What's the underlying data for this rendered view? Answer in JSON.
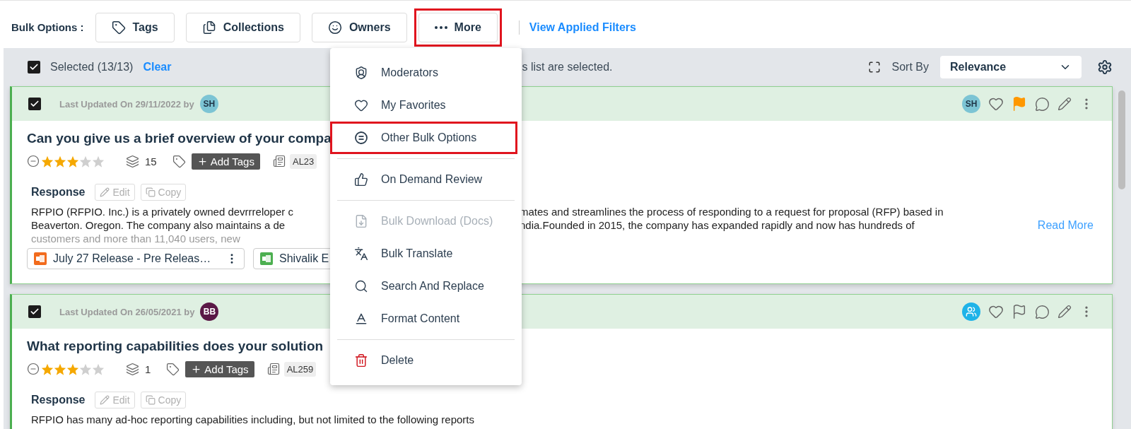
{
  "bulk_bar": {
    "label": "Bulk Options :",
    "buttons": [
      {
        "label": "Tags",
        "highlighted": false
      },
      {
        "label": "Collections",
        "highlighted": false
      },
      {
        "label": "Owners",
        "highlighted": false
      },
      {
        "label": "More",
        "highlighted": true
      }
    ],
    "filters_link": "View Applied Filters"
  },
  "selection_bar": {
    "checked": true,
    "label": "Selected (13/13)",
    "clear": "Clear",
    "message": "s list are selected.",
    "sort_label": "Sort By",
    "sort_value": "Relevance"
  },
  "cards": [
    {
      "checked": true,
      "updated": "Last Updated On 29/11/2022 by",
      "avatar": {
        "initials": "SH",
        "color": "#7cc4d4"
      },
      "owner": {
        "kind": "initials",
        "text": "SH",
        "color": "#7cc4d4"
      },
      "flagged": true,
      "title": "Can you give us a brief overview of your compa",
      "stars": 3,
      "collections": "15",
      "add_tags": "Add Tags",
      "doc_id": "AL23",
      "response_label": "Response",
      "actions": [
        {
          "label": "Edit",
          "disabled": true
        },
        {
          "label": "Copy",
          "disabled": true
        }
      ],
      "lines": [
        {
          "left": "RFPIO (RFPIO. Inc.) is a privately owned devrrreloper c",
          "right": "mates and streamlines the process of responding to a request for proposal (RFP) based in"
        },
        {
          "left": "Beaverton. Oregon. The company also maintains a de",
          "right": "ndia.Founded in 2015, the company has expanded rapidly and now has hundreds of"
        },
        {
          "left": "customers and more than 11,040 users, new",
          "faded": true
        }
      ],
      "read_more": "Read More",
      "attachments": [
        {
          "kind": "ppt",
          "name": "July 27 Release - Pre Releas…",
          "menu": true
        },
        {
          "kind": "xls",
          "name": "Shivalik E"
        }
      ]
    },
    {
      "checked": true,
      "updated": "Last Updated On 26/05/2021 by",
      "avatar": {
        "initials": "BB",
        "color": "#5a1846"
      },
      "owner": {
        "kind": "team",
        "color": "#1fb3e8"
      },
      "flagged": false,
      "title": "What reporting capabilities does your solution",
      "stars": 3,
      "collections": "1",
      "add_tags": "Add Tags",
      "doc_id": "AL259",
      "response_label": "Response",
      "actions": [
        {
          "label": "Edit",
          "disabled": true
        },
        {
          "label": "Copy",
          "disabled": true
        }
      ],
      "lines": [
        {
          "left": "RFPIO has many ad-hoc reporting capabilities including, but not limited to the following reports"
        }
      ]
    }
  ],
  "more_menu": {
    "groups": [
      {
        "items": [
          {
            "label": "Moderators",
            "disabled": false,
            "danger": false,
            "highlighted": false
          },
          {
            "label": "My Favorites",
            "disabled": false,
            "danger": false,
            "highlighted": false
          },
          {
            "label": "Other Bulk Options",
            "disabled": false,
            "danger": false,
            "highlighted": true
          }
        ]
      },
      {
        "items": [
          {
            "label": "On Demand Review",
            "disabled": false,
            "danger": false,
            "highlighted": false
          }
        ]
      },
      {
        "items": [
          {
            "label": "Bulk Download (Docs)",
            "disabled": true,
            "danger": false,
            "highlighted": false
          },
          {
            "label": "Bulk Translate",
            "disabled": false,
            "danger": false,
            "highlighted": false
          },
          {
            "label": "Search And Replace",
            "disabled": false,
            "danger": false,
            "highlighted": false
          },
          {
            "label": "Format Content",
            "disabled": false,
            "danger": false,
            "highlighted": false
          }
        ]
      },
      {
        "items": [
          {
            "label": "Delete",
            "disabled": false,
            "danger": true,
            "highlighted": false
          }
        ]
      }
    ]
  }
}
